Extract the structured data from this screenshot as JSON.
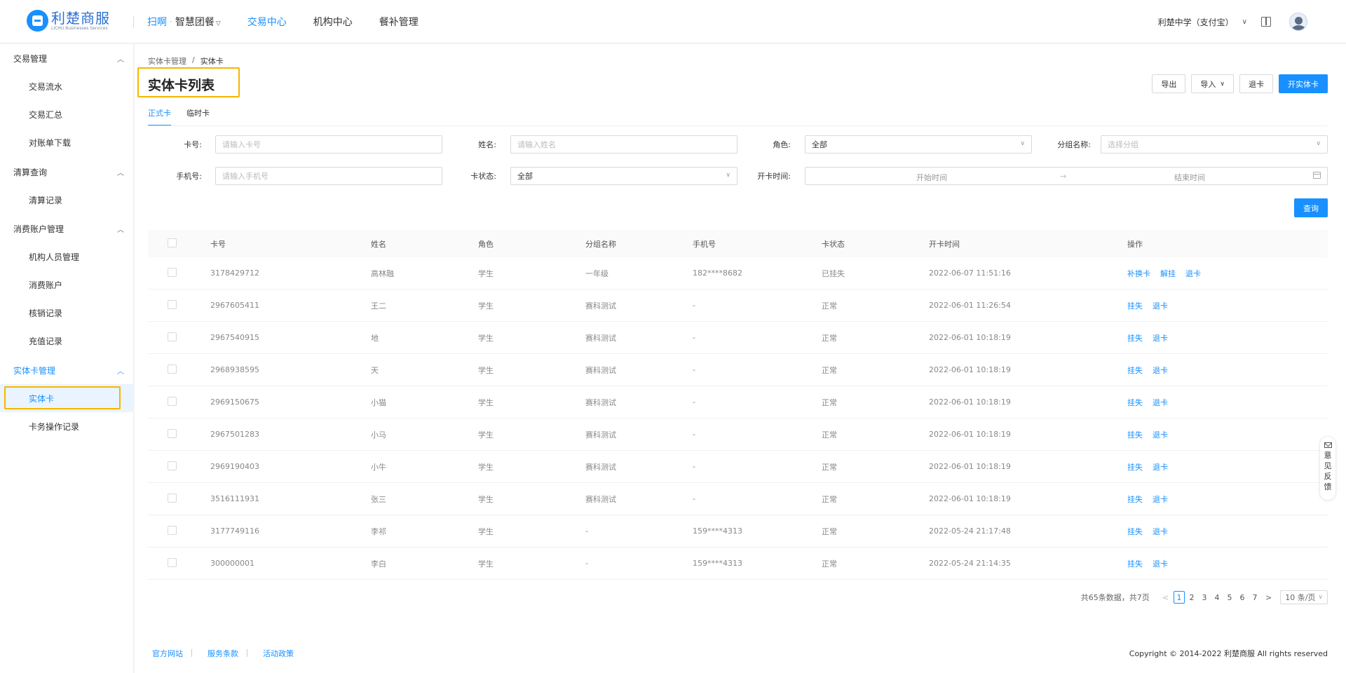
{
  "header": {
    "logo_cn": "利楚商服",
    "logo_en": "LICHU Businesses Services",
    "scan": "扫啊",
    "nav": [
      "智慧团餐",
      "交易中心",
      "机构中心",
      "餐补管理"
    ],
    "school": "利楚中学（支付宝）"
  },
  "sidebar": {
    "groups": [
      {
        "label": "交易管理",
        "items": [
          "交易流水",
          "交易汇总",
          "对账单下载"
        ]
      },
      {
        "label": "清算查询",
        "items": [
          "清算记录"
        ]
      },
      {
        "label": "消费账户管理",
        "items": [
          "机构人员管理",
          "消费账户",
          "核销记录",
          "充值记录"
        ]
      },
      {
        "label": "实体卡管理",
        "items": [
          "实体卡",
          "卡务操作记录"
        ]
      }
    ]
  },
  "breadcrumb": {
    "parent": "实体卡管理",
    "sep": "/",
    "current": "实体卡"
  },
  "page_title": "实体卡列表",
  "actions": {
    "export": "导出",
    "import": "导入",
    "refund": "退卡",
    "open": "开实体卡"
  },
  "tabs": [
    "正式卡",
    "临时卡"
  ],
  "filters": {
    "card_no": {
      "label": "卡号:",
      "placeholder": "请输入卡号"
    },
    "name": {
      "label": "姓名:",
      "placeholder": "请输入姓名"
    },
    "role": {
      "label": "角色:",
      "value": "全部"
    },
    "group": {
      "label": "分组名称:",
      "placeholder": "选择分组"
    },
    "phone": {
      "label": "手机号:",
      "placeholder": "请输入手机号"
    },
    "status": {
      "label": "卡状态:",
      "value": "全部"
    },
    "open_time": {
      "label": "开卡时间:",
      "start": "开始时间",
      "arrow": "→",
      "end": "结束时间"
    },
    "search": "查询"
  },
  "table": {
    "headers": [
      "卡号",
      "姓名",
      "角色",
      "分组名称",
      "手机号",
      "卡状态",
      "开卡时间",
      "操作"
    ],
    "rows": [
      {
        "card": "3178429712",
        "name": "高林融",
        "role": "学生",
        "group": "一年级",
        "phone": "182****8682",
        "status": "已挂失",
        "time": "2022-06-07 11:51:16",
        "ops": [
          "补换卡",
          "解挂",
          "退卡"
        ]
      },
      {
        "card": "2967605411",
        "name": "王二",
        "role": "学生",
        "group": "赛科测试",
        "phone": "-",
        "status": "正常",
        "time": "2022-06-01 11:26:54",
        "ops": [
          "挂失",
          "退卡"
        ]
      },
      {
        "card": "2967540915",
        "name": "地",
        "role": "学生",
        "group": "赛科测试",
        "phone": "-",
        "status": "正常",
        "time": "2022-06-01 10:18:19",
        "ops": [
          "挂失",
          "退卡"
        ]
      },
      {
        "card": "2968938595",
        "name": "天",
        "role": "学生",
        "group": "赛科测试",
        "phone": "-",
        "status": "正常",
        "time": "2022-06-01 10:18:19",
        "ops": [
          "挂失",
          "退卡"
        ]
      },
      {
        "card": "2969150675",
        "name": "小猫",
        "role": "学生",
        "group": "赛科测试",
        "phone": "-",
        "status": "正常",
        "time": "2022-06-01 10:18:19",
        "ops": [
          "挂失",
          "退卡"
        ]
      },
      {
        "card": "2967501283",
        "name": "小马",
        "role": "学生",
        "group": "赛科测试",
        "phone": "-",
        "status": "正常",
        "time": "2022-06-01 10:18:19",
        "ops": [
          "挂失",
          "退卡"
        ]
      },
      {
        "card": "2969190403",
        "name": "小牛",
        "role": "学生",
        "group": "赛科测试",
        "phone": "-",
        "status": "正常",
        "time": "2022-06-01 10:18:19",
        "ops": [
          "挂失",
          "退卡"
        ]
      },
      {
        "card": "3516111931",
        "name": "张三",
        "role": "学生",
        "group": "赛科测试",
        "phone": "-",
        "status": "正常",
        "time": "2022-06-01 10:18:19",
        "ops": [
          "挂失",
          "退卡"
        ]
      },
      {
        "card": "3177749116",
        "name": "李祁",
        "role": "学生",
        "group": "-",
        "phone": "159****4313",
        "status": "正常",
        "time": "2022-05-24 21:17:48",
        "ops": [
          "挂失",
          "退卡"
        ]
      },
      {
        "card": "300000001",
        "name": "李白",
        "role": "学生",
        "group": "-",
        "phone": "159****4313",
        "status": "正常",
        "time": "2022-05-24 21:14:35",
        "ops": [
          "挂失",
          "退卡"
        ]
      }
    ]
  },
  "pagination": {
    "total": "共65条数据，共7页",
    "prev": "<",
    "next": ">",
    "pages": [
      "1",
      "2",
      "3",
      "4",
      "5",
      "6",
      "7"
    ],
    "current": "1",
    "size": "10 条/页"
  },
  "footer": {
    "links": [
      "官方网站",
      "服务条款",
      "活动政策"
    ],
    "copyright": "Copyright © 2014-2022 利楚商服 All rights reserved"
  },
  "feedback": {
    "chars": [
      "意",
      "见",
      "反",
      "馈"
    ]
  },
  "colors": {
    "accent": "#1890ff",
    "highlight": "#f7b500"
  }
}
